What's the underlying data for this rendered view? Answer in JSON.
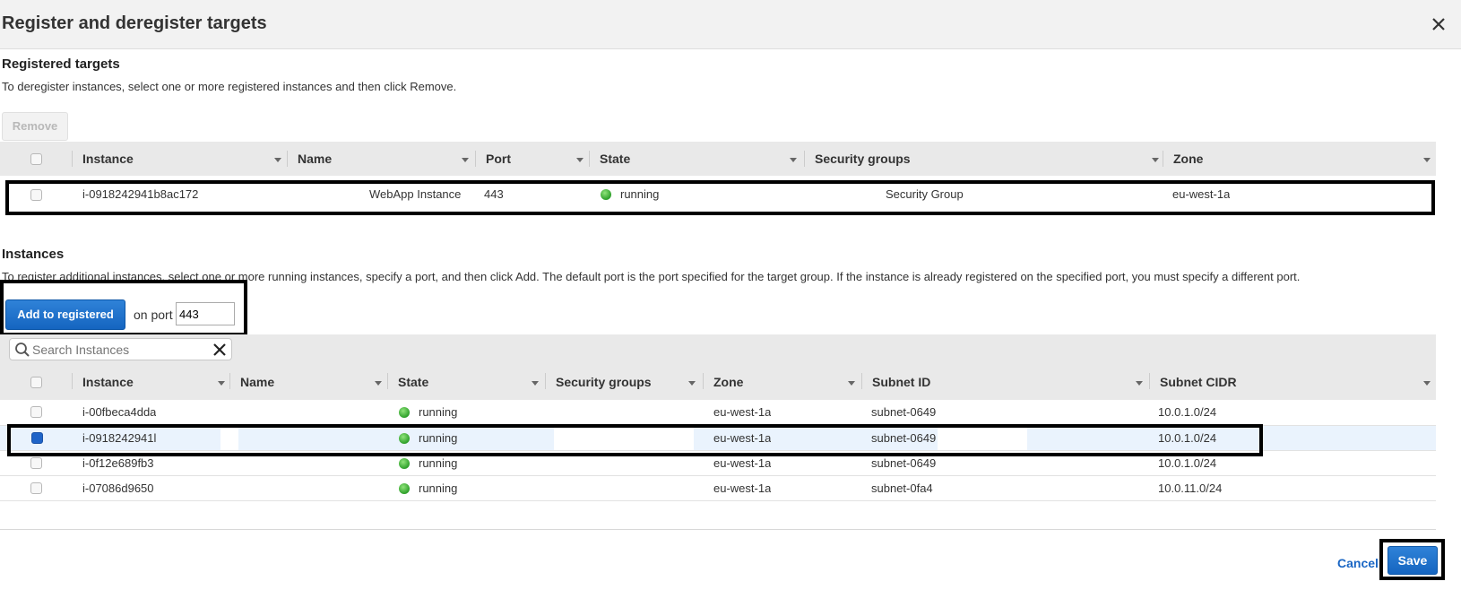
{
  "dialog": {
    "title": "Register and deregister targets",
    "close_icon": "close-icon"
  },
  "registered": {
    "title": "Registered targets",
    "description": "To deregister instances, select one or more registered instances and then click Remove.",
    "remove_label": "Remove",
    "columns": [
      "Instance",
      "Name",
      "Port",
      "State",
      "Security groups",
      "Zone"
    ],
    "rows": [
      {
        "instance": "i-0918242941b8ac172",
        "name": "WebApp Instance",
        "port": "443",
        "state": "running",
        "security_groups": "Security Group",
        "zone": "eu-west-1a",
        "checked": false
      }
    ]
  },
  "instances": {
    "title": "Instances",
    "description": "To register additional instances, select one or more running instances, specify a port, and then click Add. The default port is the port specified for the target group. If the instance is already registered on the specified port, you must specify a different port.",
    "add_label": "Add to registered",
    "on_port_label": "on port",
    "port_value": "443",
    "search_placeholder": "Search Instances",
    "columns": [
      "Instance",
      "Name",
      "State",
      "Security groups",
      "Zone",
      "Subnet ID",
      "Subnet CIDR"
    ],
    "rows": [
      {
        "instance": "i-00fbeca4dda",
        "state": "running",
        "zone": "eu-west-1a",
        "subnet_id": "subnet-0649",
        "subnet_cidr": "10.0.1.0/24",
        "checked": false
      },
      {
        "instance": "i-0918242941l",
        "state": "running",
        "zone": "eu-west-1a",
        "subnet_id": "subnet-0649",
        "subnet_cidr": "10.0.1.0/24",
        "checked": true
      },
      {
        "instance": "i-0f12e689fb3",
        "state": "running",
        "zone": "eu-west-1a",
        "subnet_id": "subnet-0649",
        "subnet_cidr": "10.0.1.0/24",
        "checked": false
      },
      {
        "instance": "i-07086d9650",
        "state": "running",
        "zone": "eu-west-1a",
        "subnet_id": "subnet-0fa4",
        "subnet_cidr": "10.0.11.0/24",
        "checked": false
      }
    ]
  },
  "footer": {
    "cancel_label": "Cancel",
    "save_label": "Save"
  },
  "colors": {
    "primary": "#1565c0",
    "status_running": "#2ea02a",
    "header_bg": "#f2f2f2",
    "selected_row_bg": "#eaf3fd",
    "highlight_border": "#000000"
  },
  "icons": {
    "search": "search-icon",
    "clear": "clear-icon",
    "sort": "sort-icon",
    "status": "running-status-icon"
  }
}
